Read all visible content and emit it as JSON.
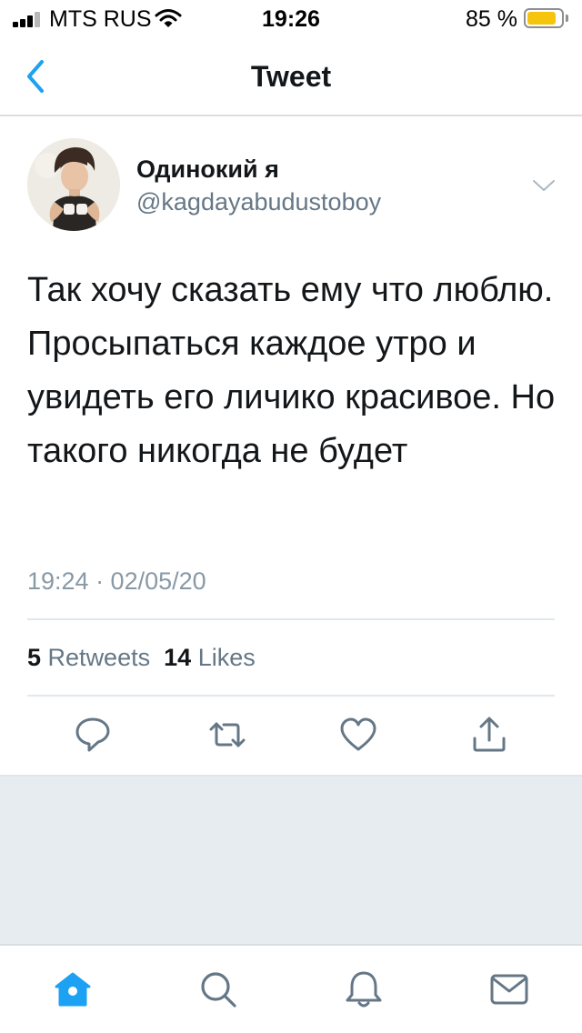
{
  "status_bar": {
    "carrier": "MTS RUS",
    "time": "19:26",
    "battery_percent": "85 %",
    "battery_level": 0.85,
    "battery_color": "#f6c40d",
    "signal_icon": "cellular-signal-icon",
    "wifi_icon": "wifi-icon"
  },
  "nav": {
    "title": "Tweet",
    "back_icon": "chevron-left-icon"
  },
  "tweet": {
    "display_name": "Одинокий я",
    "handle": "@kagdayabudustoboy",
    "text": "Так хочу сказать ему что люблю. Просыпаться каждое утро и увидеть его личико красивое. Но такого никогда не будет",
    "timestamp": "19:24 · 02/05/20",
    "retweets_count": "5",
    "retweets_label": "Retweets",
    "likes_count": "14",
    "likes_label": "Likes",
    "more_icon": "chevron-down-icon"
  },
  "actions": [
    {
      "icon": "reply-icon"
    },
    {
      "icon": "retweet-icon"
    },
    {
      "icon": "heart-icon"
    },
    {
      "icon": "share-icon"
    }
  ],
  "tab_bar": [
    {
      "icon": "home-icon",
      "active": true
    },
    {
      "icon": "search-icon",
      "active": false
    },
    {
      "icon": "bell-icon",
      "active": false
    },
    {
      "icon": "mail-icon",
      "active": false
    }
  ],
  "colors": {
    "accent": "#1da1f2",
    "icon_gray": "#657786",
    "text": "#14171a",
    "secondary_text": "#657786",
    "background_gray": "#e6ecf0"
  }
}
